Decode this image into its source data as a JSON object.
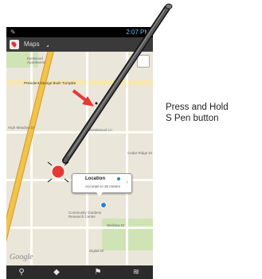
{
  "status_bar": {
    "time": "2:07 PM"
  },
  "app_bar": {
    "title": "Maps"
  },
  "map": {
    "labels": {
      "apartments": "Eastwood\nApartments",
      "president_street": "President George Bush Turnpike",
      "high_meadow": "High Meadow Dr",
      "breakwood": "Breakwood Ln",
      "cedar_ridge": "Cedar Ridge Dr",
      "gardens": "Community Gardens\nResearch Center",
      "digital_dr": "Digital Dr",
      "wicklow": "Wicklow Dr"
    },
    "callout": {
      "title": "Location",
      "subtitle": "Accurate to 30 meters"
    },
    "attribution": "Google"
  },
  "bottom_bar": {
    "icons": [
      "search-icon",
      "directions-icon",
      "places-icon",
      "layers-icon"
    ]
  },
  "annotation": {
    "line1": "Press and Hold",
    "line2": "S Pen button"
  },
  "colors": {
    "arrow": "#e53935",
    "pen": "#3a3a3a",
    "highlight_road": "#f3c24d"
  }
}
